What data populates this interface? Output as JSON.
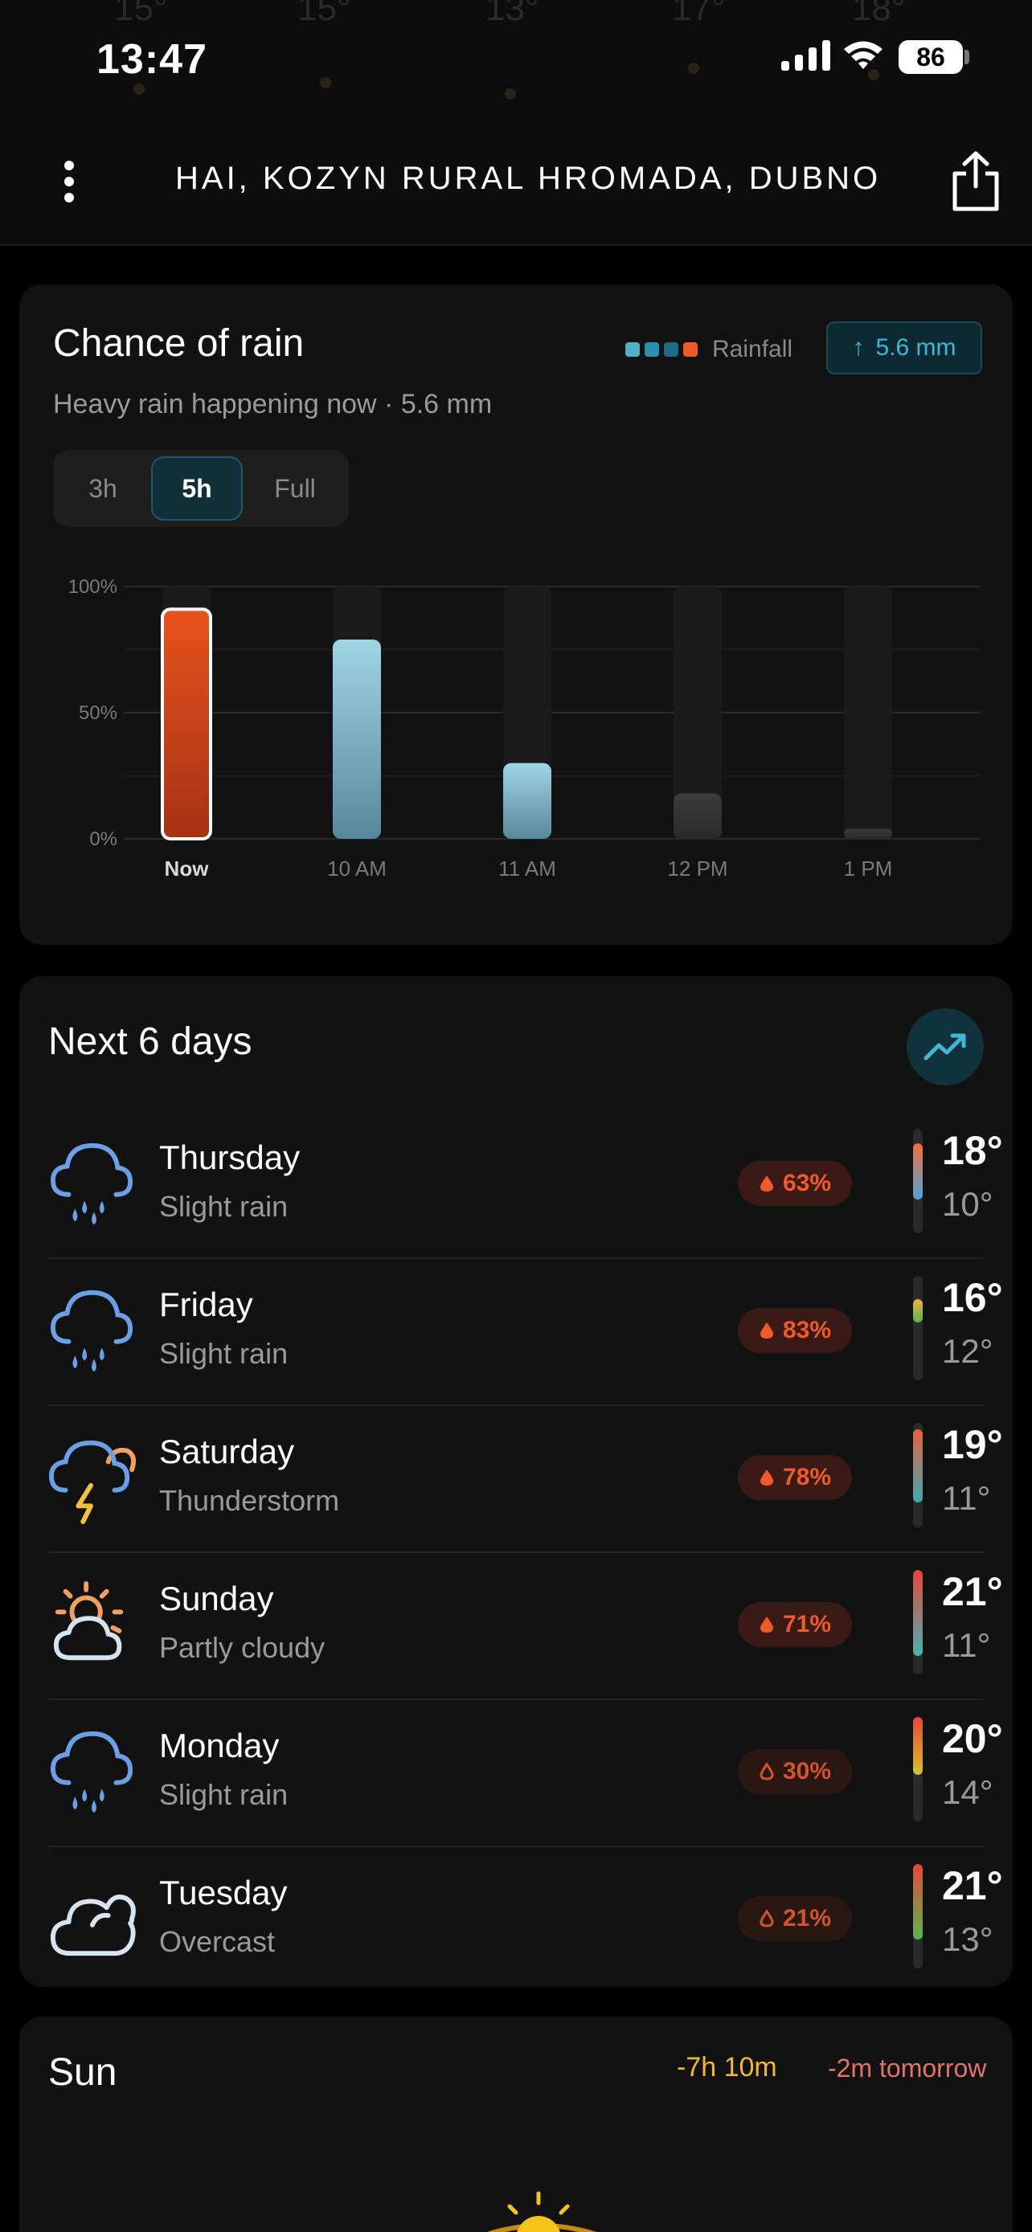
{
  "status_bar": {
    "time": "13:47",
    "battery": "86"
  },
  "background_temps": [
    "15°",
    "15°",
    "13°",
    "17°",
    "18°"
  ],
  "header": {
    "location": "HAI, KOZYN RURAL HROMADA, DUBNO…"
  },
  "rain": {
    "title": "Chance of rain",
    "subtitle": "Heavy rain happening now · 5.6 mm",
    "legend_label": "Rainfall",
    "legend_colors": [
      "#4fb0c8",
      "#2b8fb0",
      "#1f6a86",
      "#f05a28"
    ],
    "badge_arrow": "↑",
    "badge": "5.6 mm",
    "ranges": [
      "3h",
      "5h",
      "Full"
    ],
    "active_range": "5h"
  },
  "chart_data": {
    "type": "bar",
    "categories": [
      "Now",
      "10 AM",
      "11 AM",
      "12 PM",
      "1 PM"
    ],
    "values": [
      91,
      79,
      30,
      18,
      4
    ],
    "ylim": [
      0,
      100
    ],
    "yticks": [
      "0%",
      "50%",
      "100%"
    ],
    "highlight_index": 0
  },
  "days": {
    "title": "Next 6 days",
    "items": [
      {
        "name": "Thursday",
        "cond": "Slight rain",
        "icon": "rain-cloud-icon",
        "precip": "63%",
        "high": "18°",
        "low": "10°",
        "filled": true,
        "bar": [
          0.14,
          0.68
        ],
        "colors": [
          "#f0703a",
          "#4fa4d8"
        ]
      },
      {
        "name": "Friday",
        "cond": "Slight rain",
        "icon": "rain-cloud-icon",
        "precip": "83%",
        "high": "16°",
        "low": "12°",
        "filled": true,
        "bar": [
          0.22,
          0.44
        ],
        "colors": [
          "#f2b040",
          "#58b84c"
        ]
      },
      {
        "name": "Saturday",
        "cond": "Thunderstorm",
        "icon": "thunderstorm-icon",
        "precip": "78%",
        "high": "19°",
        "low": "11°",
        "filled": true,
        "bar": [
          0.06,
          0.76
        ],
        "colors": [
          "#e9613f",
          "#3ea9b0"
        ]
      },
      {
        "name": "Sunday",
        "cond": "Partly cloudy",
        "icon": "partly-cloudy-icon",
        "precip": "71%",
        "high": "21°",
        "low": "11°",
        "filled": true,
        "bar": [
          0.0,
          0.82
        ],
        "colors": [
          "#e54838",
          "#4ab0b0"
        ]
      },
      {
        "name": "Monday",
        "cond": "Slight rain",
        "icon": "rain-cloud-icon",
        "precip": "30%",
        "high": "20°",
        "low": "14°",
        "filled": false,
        "bar": [
          0.0,
          0.55
        ],
        "colors": [
          "#e54838",
          "#d8c030"
        ]
      },
      {
        "name": "Tuesday",
        "cond": "Overcast",
        "icon": "cloud-icon",
        "precip": "21%",
        "high": "21°",
        "low": "13°",
        "filled": false,
        "bar": [
          0.0,
          0.72
        ],
        "colors": [
          "#e54838",
          "#58b84c"
        ]
      }
    ]
  },
  "sun": {
    "title": "Sun",
    "delta_today": "-7h 10m",
    "delta_tomorrow": "-2m tomorrow",
    "today_color": "#f2b92c",
    "tomorrow_color": "#e3736a"
  }
}
